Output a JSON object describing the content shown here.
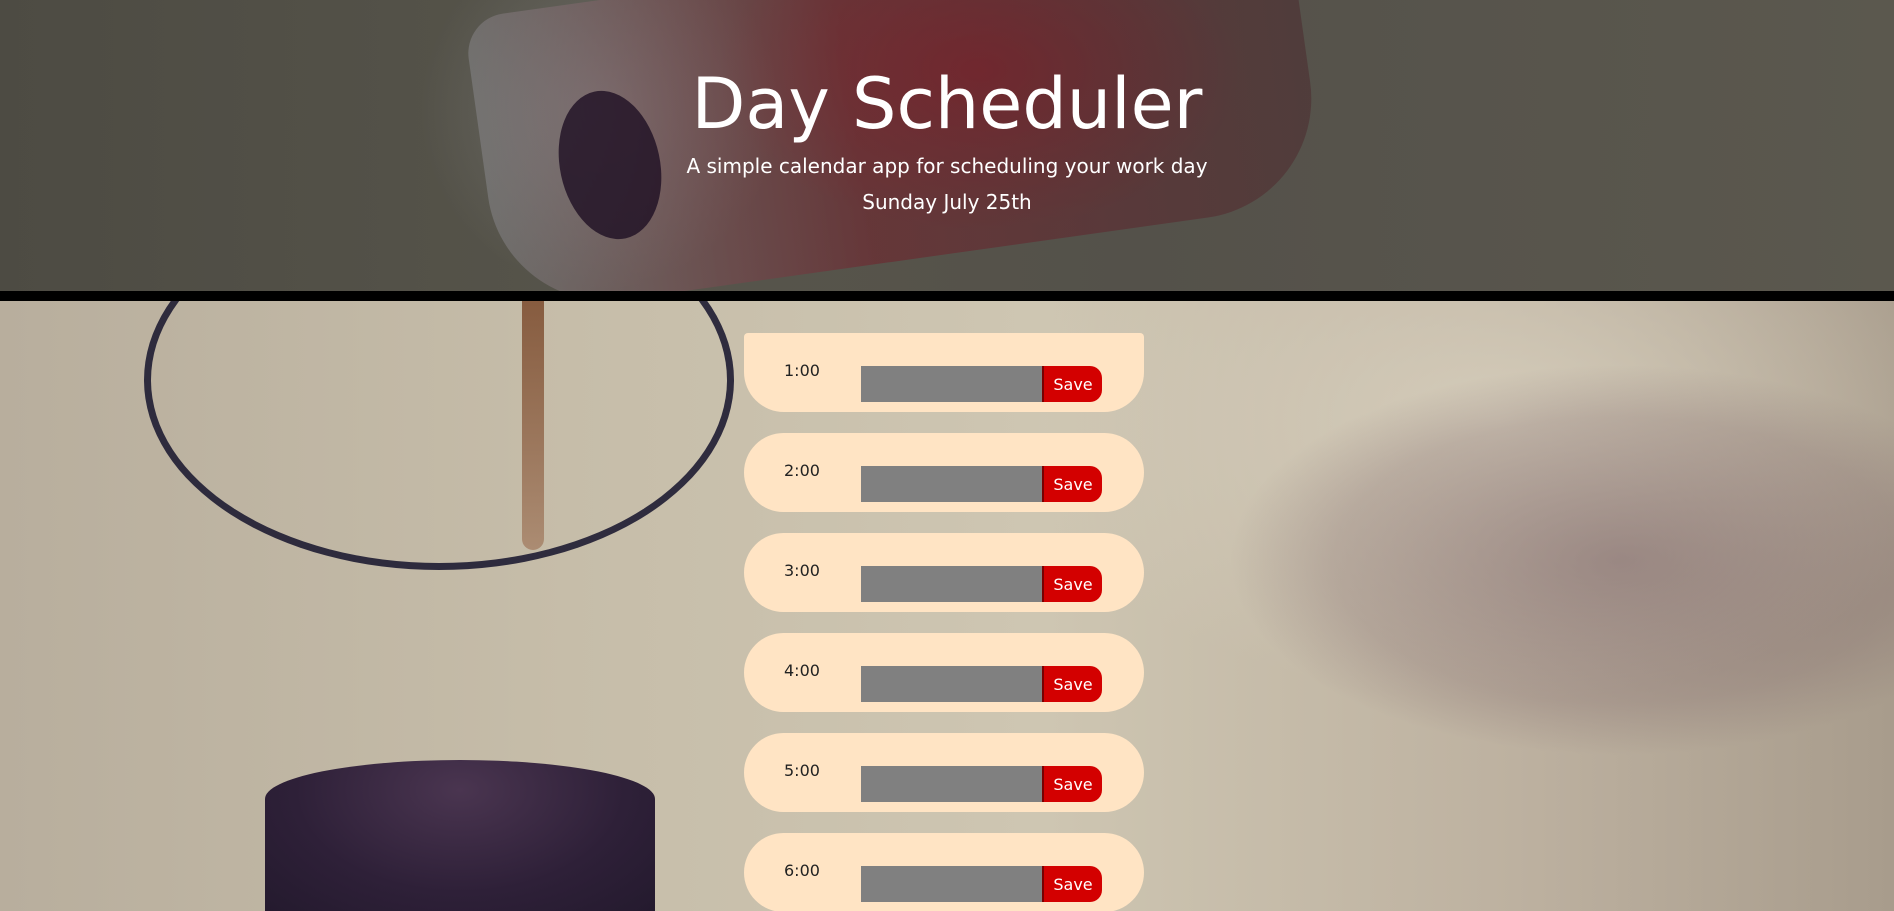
{
  "header": {
    "title": "Day Scheduler",
    "subtitle": "A simple calendar app for scheduling your work day",
    "current_day": "Sunday July 25th"
  },
  "schedule": {
    "save_label": "Save",
    "rows": [
      {
        "hour": "1:00",
        "task": ""
      },
      {
        "hour": "2:00",
        "task": ""
      },
      {
        "hour": "3:00",
        "task": ""
      },
      {
        "hour": "4:00",
        "task": ""
      },
      {
        "hour": "5:00",
        "task": ""
      },
      {
        "hour": "6:00",
        "task": ""
      }
    ]
  },
  "colors": {
    "row_background": "#ffe4c4",
    "task_field": "#808080",
    "save_button": "#d30000",
    "divider": "#000000",
    "title_text": "#ffffff"
  }
}
